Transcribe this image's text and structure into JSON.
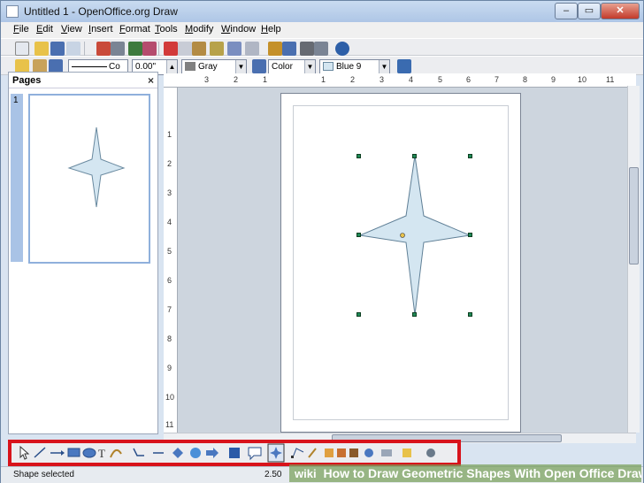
{
  "window": {
    "title": "Untitled 1 - OpenOffice.org Draw",
    "minimize": "–",
    "maximize": "▭",
    "close": "✕"
  },
  "menubar": [
    "File",
    "Edit",
    "View",
    "Insert",
    "Format",
    "Tools",
    "Modify",
    "Window",
    "Help"
  ],
  "line_toolbar": {
    "line_style": "Co",
    "line_width": "0.00\"",
    "line_color": "Gray",
    "area_style": "Color",
    "area_color": "Blue 9"
  },
  "pages_panel": {
    "header": "Pages",
    "close": "×",
    "page_number": "1"
  },
  "ruler": {
    "h_ticks": [
      "3",
      "2",
      "1",
      "1",
      "2",
      "3",
      "4",
      "5",
      "6",
      "7",
      "8",
      "9",
      "10",
      "11"
    ],
    "v_ticks": [
      "1",
      "2",
      "3",
      "4",
      "5",
      "6",
      "7",
      "8",
      "9",
      "10",
      "11"
    ]
  },
  "status": {
    "text": "Shape selected",
    "coords": "2.50"
  },
  "watermark": {
    "logo": "wiki",
    "caption": "How to Draw Geometric Shapes With Open Office Draw"
  },
  "colors": {
    "shape_fill": "#d4e6f1",
    "highlight": "#d8131b"
  },
  "icons": [
    "select-arrow-icon",
    "line-icon",
    "arrow-line-icon",
    "rectangle-icon",
    "ellipse-icon",
    "text-icon",
    "curve-icon",
    "connector-icon",
    "basic-shapes-icon",
    "symbol-shapes-icon",
    "block-arrows-icon",
    "flowcharts-icon",
    "callouts-icon",
    "stars-icon",
    "points-icon",
    "glue-icon",
    "fontwork-icon",
    "from-file-icon",
    "gallery-icon",
    "rotate-icon",
    "align-icon",
    "arrange-icon",
    "extrusion-icon"
  ]
}
